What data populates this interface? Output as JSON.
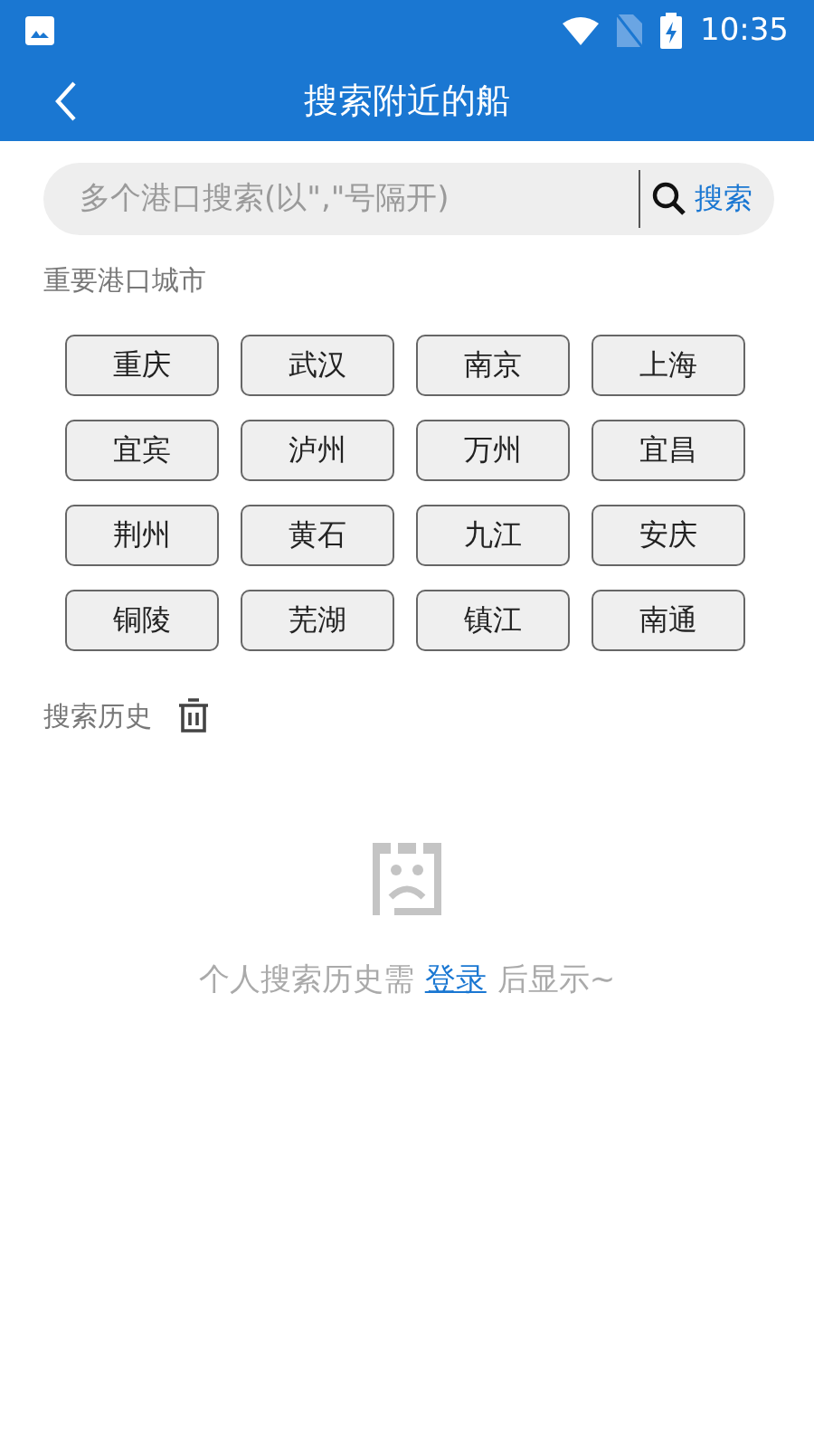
{
  "status_bar": {
    "time": "10:35"
  },
  "app_bar": {
    "title": "搜索附近的船"
  },
  "search": {
    "placeholder": "多个港口搜索(以\",\"号隔开)",
    "button": "搜索"
  },
  "ports": {
    "title": "重要港口城市",
    "cities": [
      "重庆",
      "武汉",
      "南京",
      "上海",
      "宜宾",
      "泸州",
      "万州",
      "宜昌",
      "荆州",
      "黄石",
      "九江",
      "安庆",
      "铜陵",
      "芜湖",
      "镇江",
      "南通"
    ]
  },
  "history": {
    "title": "搜索历史",
    "empty_message": {
      "before": "个人搜索历史需",
      "link": "登录",
      "after": "后显示~"
    }
  }
}
